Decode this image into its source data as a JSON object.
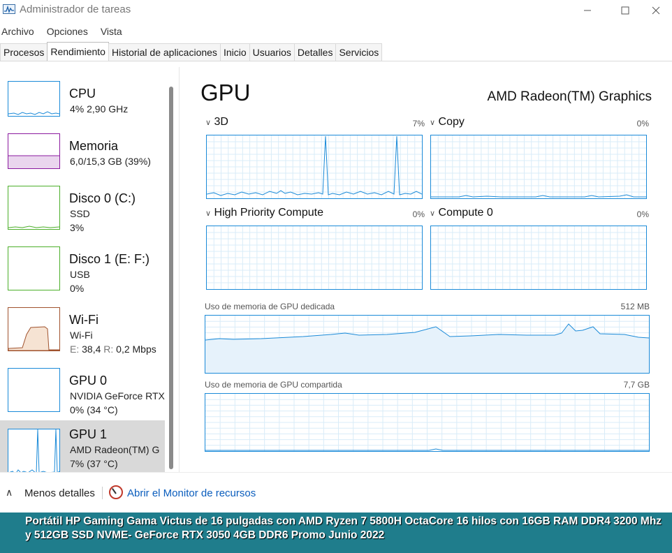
{
  "window": {
    "title": "Administrador de tareas"
  },
  "menu": [
    "Archivo",
    "Opciones",
    "Vista"
  ],
  "tabs": [
    "Procesos",
    "Rendimiento",
    "Historial de aplicaciones",
    "Inicio",
    "Usuarios",
    "Detalles",
    "Servicios"
  ],
  "active_tab": "Rendimiento",
  "sidebar": {
    "items": [
      {
        "title": "CPU",
        "sub1": "4%  2,90 GHz",
        "sub2": "",
        "color": "#1a8ad8"
      },
      {
        "title": "Memoria",
        "sub1": "6,0/15,3 GB (39%)",
        "sub2": "",
        "color": "#8b1a9f"
      },
      {
        "title": "Disco 0 (C:)",
        "sub1": "SSD",
        "sub2": "3%",
        "color": "#4caf2a"
      },
      {
        "title": "Disco 1 (E: F:)",
        "sub1": "USB",
        "sub2": "0%",
        "color": "#4caf2a"
      },
      {
        "title": "Wi-Fi",
        "sub1": "Wi-Fi",
        "sub2_prefix_e": "E:",
        "sub2_e": "38,4",
        "sub2_prefix_r": "R:",
        "sub2_r": "0,2 Mbps",
        "color": "#a0522d"
      },
      {
        "title": "GPU 0",
        "sub1": "NVIDIA GeForce RTX",
        "sub2": "0%  (34 °C)",
        "color": "#1a8ad8"
      },
      {
        "title": "GPU 1",
        "sub1": "AMD Radeon(TM) G",
        "sub2": "7%  (37 °C)",
        "color": "#1a8ad8"
      }
    ]
  },
  "main": {
    "title": "GPU",
    "device": "AMD Radeon(TM) Graphics",
    "engines": [
      {
        "name": "3D",
        "percent": "7%"
      },
      {
        "name": "Copy",
        "percent": "0%"
      },
      {
        "name": "High Priority Compute",
        "percent": "0%"
      },
      {
        "name": "Compute 0",
        "percent": "0%"
      }
    ],
    "dedicated": {
      "label": "Uso de memoria de GPU dedicada",
      "value": "512 MB"
    },
    "shared": {
      "label": "Uso de memoria de GPU compartida",
      "value": "7,7 GB"
    }
  },
  "footer": {
    "less_details": "Menos detalles",
    "resmon": "Abrir el Monitor de recursos"
  },
  "banner": {
    "text": "Portátil HP Gaming Gama Victus de 16 pulgadas con AMD Ryzen 7 5800H OctaCore 16 hilos con 16GB RAM DDR4 3200 Mhz y 512GB SSD NVME- GeForce RTX 3050 4GB DDR6 Promo Junio 2022"
  },
  "colors": {
    "accent": "#1a8ad8",
    "banner": "#1f7d8c",
    "link": "#0a5dbd"
  }
}
